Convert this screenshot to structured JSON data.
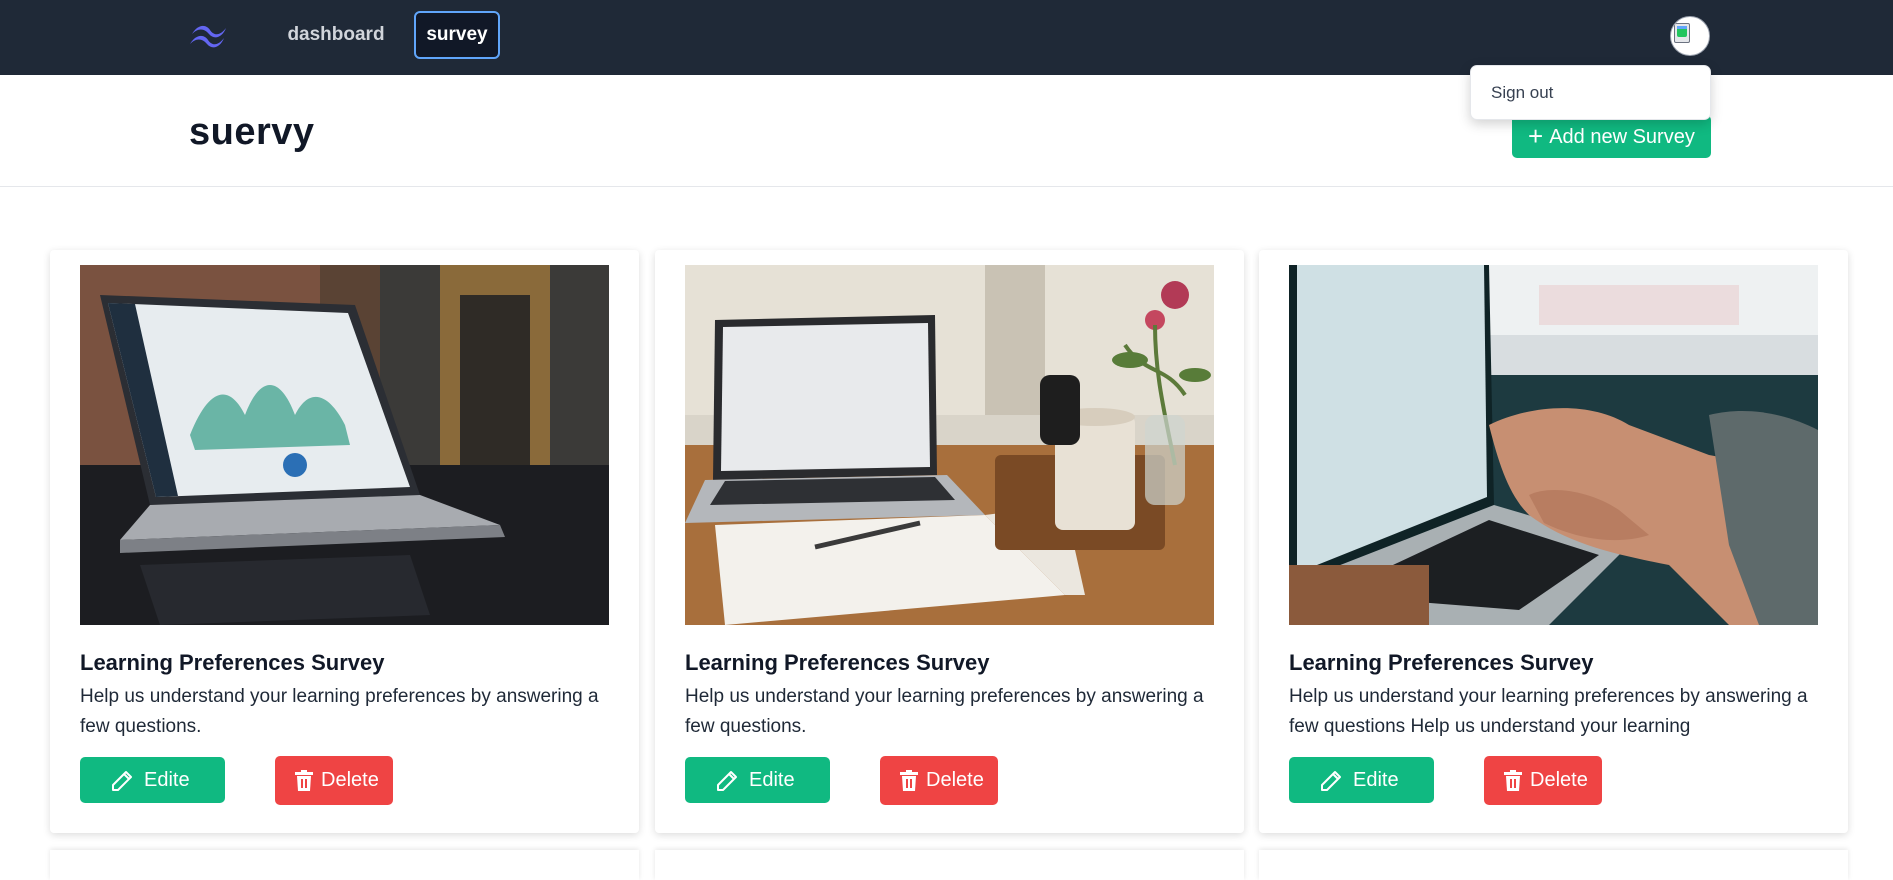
{
  "nav": {
    "logo_icon": "tailwind-logo-icon",
    "items": [
      {
        "label": "dashboard",
        "active": false
      },
      {
        "label": "survey",
        "active": true
      }
    ],
    "avatar_icon": "broken-image-icon"
  },
  "dropdown": {
    "items": [
      {
        "label": "Sign out"
      }
    ]
  },
  "header": {
    "title": "suervy",
    "add_button": {
      "icon": "plus-icon",
      "label": "Add new Survey"
    }
  },
  "cards": [
    {
      "image_icon": "laptop-dashboard-photo",
      "title": "Learning Preferences Survey",
      "description": "Help us understand your learning preferences by answering a few questions.",
      "edit_label": "Edite",
      "delete_label": "Delete"
    },
    {
      "image_icon": "laptop-desk-notebook-photo",
      "title": "Learning Preferences Survey",
      "description": "Help us understand your learning preferences by answering a few questions.",
      "edit_label": "Edite",
      "delete_label": "Delete"
    },
    {
      "image_icon": "hands-typing-laptop-photo",
      "title": "Learning Preferences Survey",
      "description": "Help us understand your learning preferences by answering a few questions Help us understand your learning",
      "edit_label": "Edite",
      "delete_label": "Delete"
    }
  ],
  "colors": {
    "navbar_bg": "#1f2937",
    "primary_green": "#10b981",
    "danger_red": "#ef4444",
    "active_outline": "#60a5fa",
    "logo": "#6366f1"
  }
}
